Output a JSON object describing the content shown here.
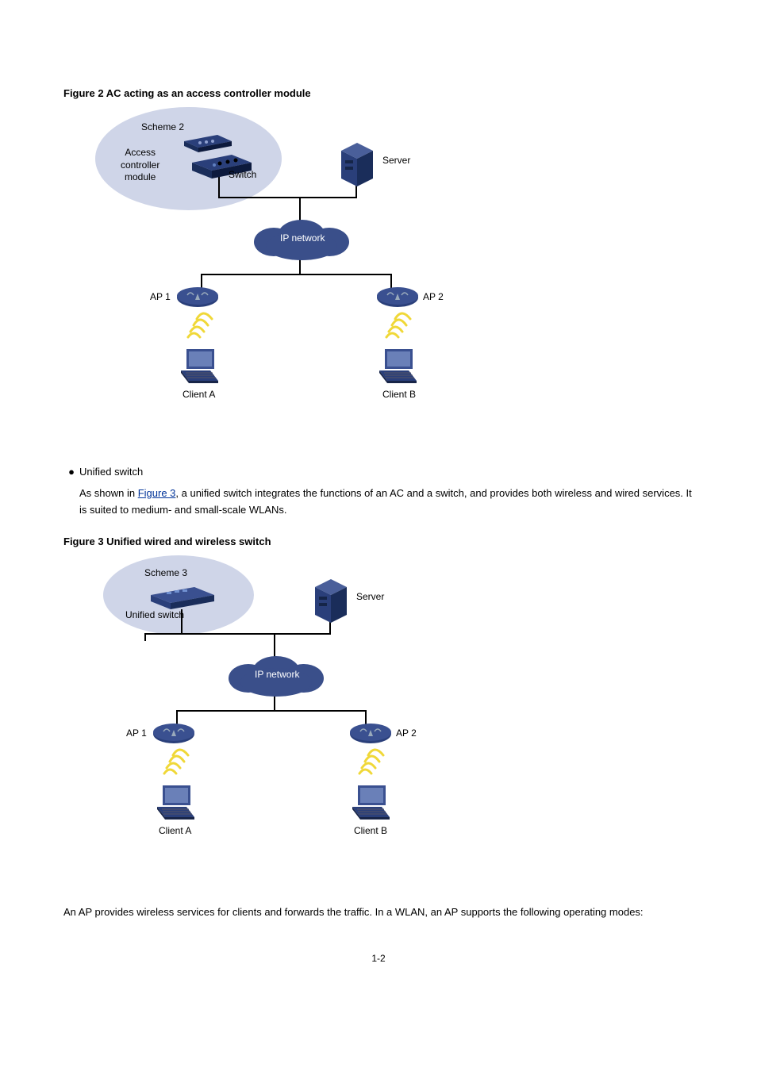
{
  "figure2": {
    "title": "Figure 2 AC acting as an access controller module",
    "scheme_label": "Scheme 2",
    "acm_label": "Access controller module",
    "switch_label": "Switch",
    "server_label": "Server",
    "ip_label": "IP network",
    "ap1_label": "AP 1",
    "ap2_label": "AP 2",
    "clientA_label": "Client A",
    "clientB_label": "Client B"
  },
  "text_block": {
    "bullet_prefix": "Unified switch",
    "bullet_body": "As shown in ",
    "bullet_link": "Figure 3",
    "bullet_after": ", a unified switch integrates the functions of an AC and a switch, and provides both wireless and wired services. It is suited to medium- and small-scale WLANs."
  },
  "figure3": {
    "title": "Figure 3 Unified wired and wireless switch",
    "scheme_label": "Scheme 3",
    "switch_label": "Unified switch",
    "server_label": "Server",
    "ip_label": "IP network",
    "ap1_label": "AP 1",
    "ap2_label": "AP 2",
    "clientA_label": "Client A",
    "clientB_label": "Client B"
  },
  "para2": "An AP provides wireless services for clients and forwards the traffic. In a WLAN, an AP supports the following operating modes:",
  "page_num": "1-2"
}
